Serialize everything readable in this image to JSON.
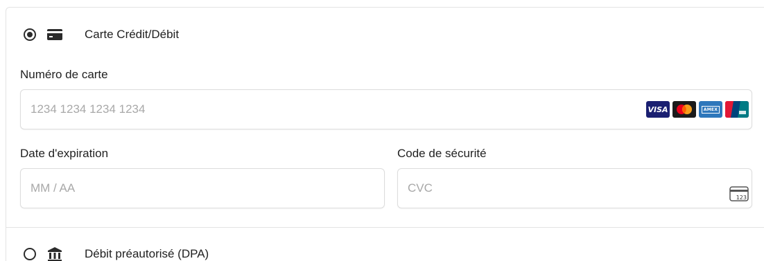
{
  "payment_methods": {
    "card": {
      "label": "Carte Crédit/Débit",
      "selected": true,
      "icon": "credit-card-icon"
    },
    "pad": {
      "label": "Débit préautorisé (DPA)",
      "selected": false,
      "icon": "bank-icon"
    }
  },
  "card_form": {
    "card_number": {
      "label": "Numéro de carte",
      "placeholder": "1234 1234 1234 1234",
      "value": ""
    },
    "expiry": {
      "label": "Date d'expiration",
      "placeholder": "MM / AA",
      "value": ""
    },
    "cvc": {
      "label": "Code de sécurité",
      "placeholder": "CVC",
      "value": "",
      "icon_text": "123"
    },
    "brands": [
      {
        "name": "visa-logo",
        "text": "VISA"
      },
      {
        "name": "mastercard-logo",
        "text": ""
      },
      {
        "name": "amex-logo",
        "text": "AMEX"
      },
      {
        "name": "unionpay-logo",
        "text": ""
      }
    ]
  },
  "colors": {
    "border": "#e3e3e3",
    "text": "#1f1f1f",
    "placeholder": "#a8a8a8",
    "visa": "#1a1f71",
    "amex": "#2e77bb",
    "unionpay_red": "#e21836"
  }
}
